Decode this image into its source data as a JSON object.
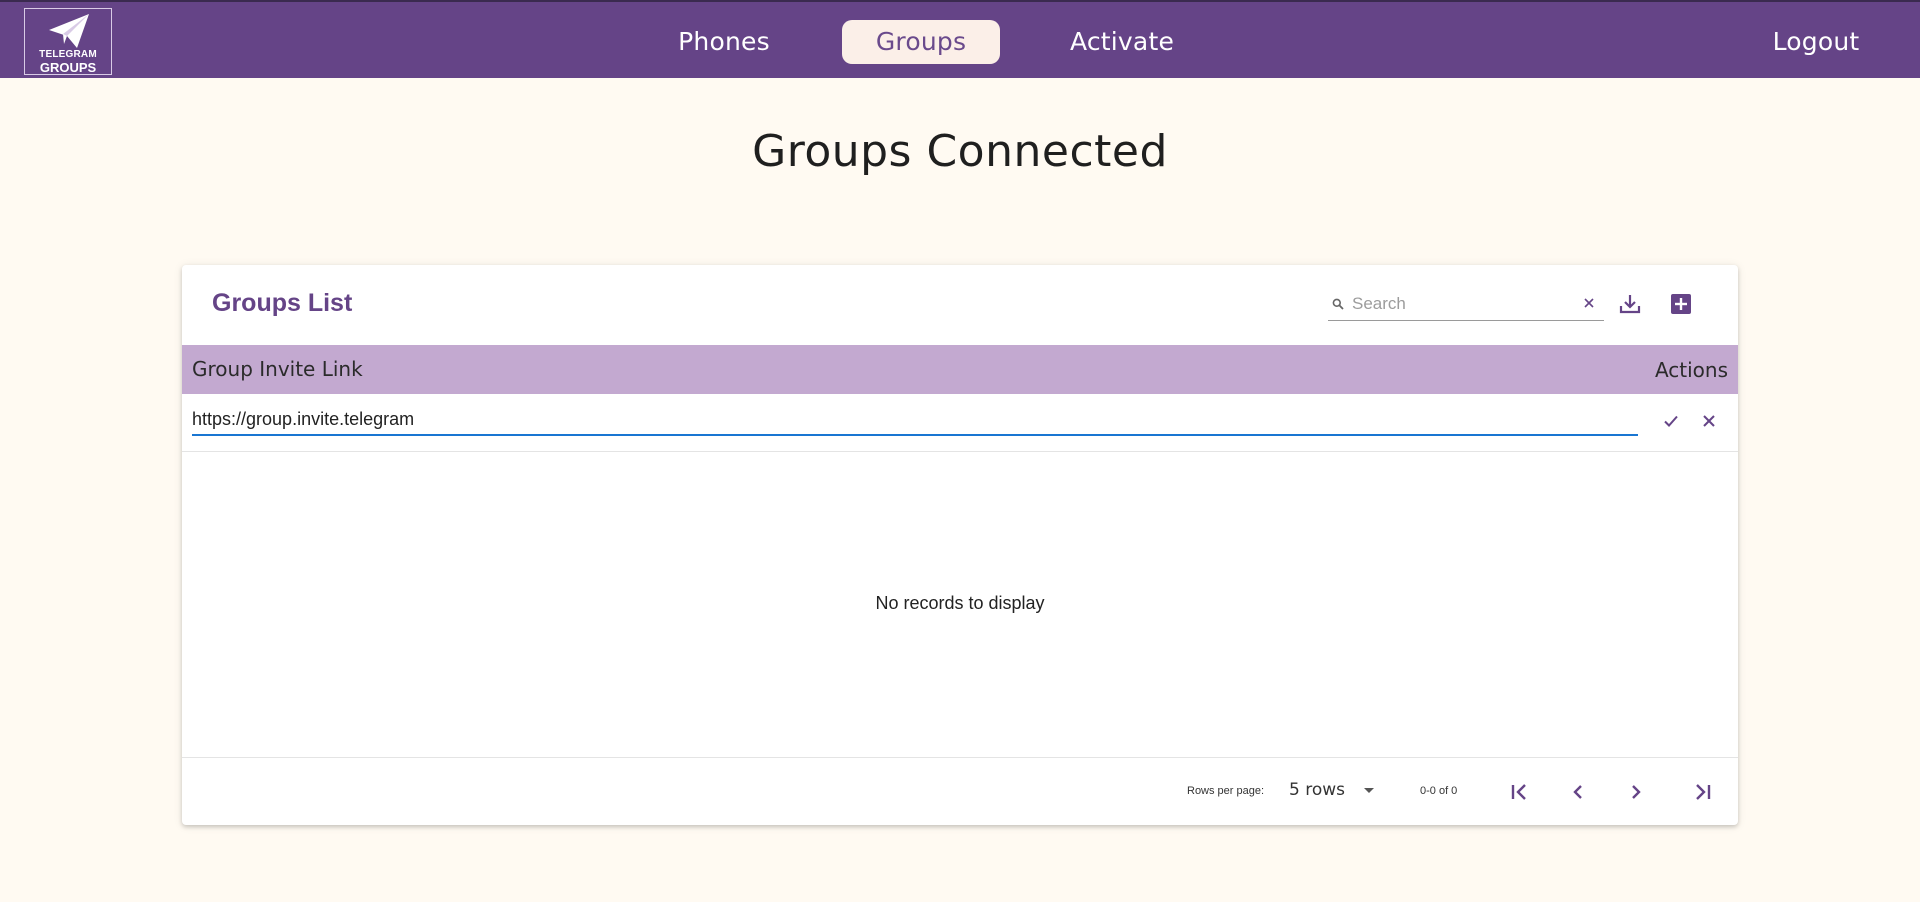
{
  "brand": {
    "logo_line1": "TELEGRAM",
    "logo_line2": "GROUPS",
    "icon": "paper-plane-icon",
    "color": "#654487"
  },
  "nav": {
    "items": [
      {
        "label": "Phones",
        "active": false
      },
      {
        "label": "Groups",
        "active": true
      },
      {
        "label": "Activate",
        "active": false
      }
    ],
    "logout_label": "Logout"
  },
  "page": {
    "title": "Groups Connected"
  },
  "card": {
    "title": "Groups List",
    "search": {
      "placeholder": "Search",
      "value": "",
      "icon": "search-icon",
      "clear_icon": "close-icon"
    },
    "actions": {
      "download_icon": "download-icon",
      "add_icon": "add-box-icon"
    },
    "table": {
      "columns": [
        "Group Invite Link",
        "Actions"
      ],
      "header_color": "#c3a9d0",
      "edit_row": {
        "value": "https://group.invite.telegram",
        "confirm_icon": "check-icon",
        "cancel_icon": "close-icon"
      },
      "empty_message": "No records to display"
    },
    "pagination": {
      "rows_per_page_label": "Rows per page:",
      "rows_per_page_value": "5 rows",
      "range_text": "0-0 of 0",
      "first_icon": "first-page-icon",
      "prev_icon": "chevron-left-icon",
      "next_icon": "chevron-right-icon",
      "last_icon": "last-page-icon"
    }
  }
}
